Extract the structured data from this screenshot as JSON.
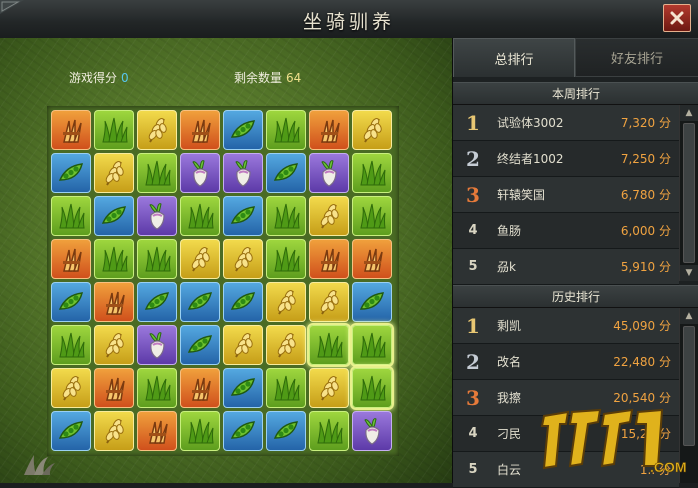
{
  "window": {
    "title": "坐骑驯养"
  },
  "stats": {
    "score_label": "游戏得分",
    "score_value": "0",
    "remain_label": "剩余数量",
    "remain_value": "64"
  },
  "tabs": [
    {
      "label": "总排行"
    },
    {
      "label": "好友排行"
    }
  ],
  "weekly": {
    "title": "本周排行",
    "rows": [
      {
        "rank": "1",
        "name": "试验体3002",
        "score": "7,320 分"
      },
      {
        "rank": "2",
        "name": "终结者1002",
        "score": "7,250 分"
      },
      {
        "rank": "3",
        "name": "轩辕笑国",
        "score": "6,780 分"
      },
      {
        "rank": "4",
        "name": "鱼肠",
        "score": "6,000 分"
      },
      {
        "rank": "5",
        "name": "刕k",
        "score": "5,910 分"
      }
    ]
  },
  "history": {
    "title": "历史排行",
    "rows": [
      {
        "rank": "1",
        "name": "剩凯",
        "score": "45,090 分"
      },
      {
        "rank": "2",
        "name": "改名",
        "score": "22,480 分"
      },
      {
        "rank": "3",
        "name": "我擦",
        "score": "20,540 分"
      },
      {
        "rank": "4",
        "name": "刁民",
        "score": "15,2.. 分"
      },
      {
        "rank": "5",
        "name": "白云",
        "score": "1.. 分"
      }
    ]
  },
  "board": {
    "tile_types": {
      "W": "wheat-bundle",
      "G": "grass",
      "E": "wheat-ear",
      "P": "pea-pod",
      "R": "radish"
    },
    "colors": {
      "W": "#e07a2a",
      "G": "#7bbf2e",
      "E": "#e4c234",
      "P": "#3b86c8",
      "R": "#7a58c4"
    },
    "rows": [
      [
        "W",
        "G",
        "E",
        "W",
        "P",
        "G",
        "W",
        "E"
      ],
      [
        "P",
        "E",
        "G",
        "R",
        "R",
        "P",
        "R",
        "G"
      ],
      [
        "G",
        "P",
        "R",
        "G",
        "P",
        "G",
        "E",
        "G"
      ],
      [
        "W",
        "G",
        "G",
        "E",
        "E",
        "G",
        "W",
        "W"
      ],
      [
        "P",
        "W",
        "P",
        "P",
        "P",
        "E",
        "E",
        "P"
      ],
      [
        "G",
        "E",
        "R",
        "P",
        "E",
        "E",
        "G",
        "G"
      ],
      [
        "E",
        "W",
        "G",
        "W",
        "P",
        "G",
        "E",
        "G"
      ],
      [
        "P",
        "E",
        "W",
        "G",
        "P",
        "P",
        "G",
        "R"
      ]
    ],
    "selected": [
      [
        5,
        6
      ],
      [
        5,
        7
      ],
      [
        6,
        7
      ]
    ]
  },
  "watermark": "17173.COM"
}
